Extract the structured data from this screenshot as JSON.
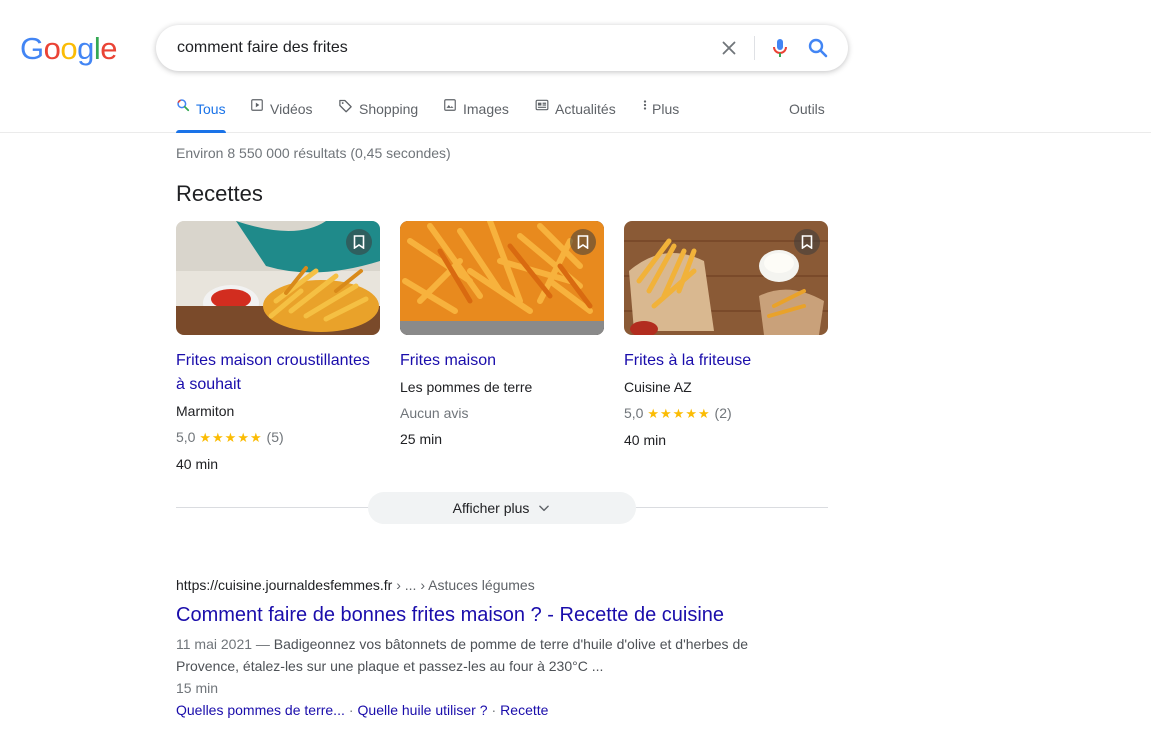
{
  "logo": {
    "letters": [
      "G",
      "o",
      "o",
      "g",
      "l",
      "e"
    ],
    "colors": [
      "#4285f4",
      "#ea4335",
      "#fbbc05",
      "#4285f4",
      "#34a853",
      "#ea4335"
    ]
  },
  "search": {
    "query": "comment faire des frites"
  },
  "tabs": [
    {
      "label": "Tous",
      "icon": "search-icon",
      "active": true
    },
    {
      "label": "Vidéos",
      "icon": "play-icon"
    },
    {
      "label": "Shopping",
      "icon": "tag-icon"
    },
    {
      "label": "Images",
      "icon": "image-icon"
    },
    {
      "label": "Actualités",
      "icon": "news-icon"
    },
    {
      "label": "Plus",
      "icon": "more-vert-icon"
    }
  ],
  "tools_label": "Outils",
  "stats": "Environ 8 550 000 résultats (0,45 secondes)",
  "section_title": "Recettes",
  "recipes": [
    {
      "title": "Frites maison croustillantes à souhait",
      "source": "Marmiton",
      "rating": "5,0",
      "stars": "★★★★★",
      "reviews": "(5)",
      "time": "40 min"
    },
    {
      "title": "Frites maison",
      "source": "Les pommes de terre",
      "meta": "Aucun avis",
      "time": "25 min"
    },
    {
      "title": "Frites à la friteuse",
      "source": "Cuisine AZ",
      "rating": "5,0",
      "stars": "★★★★★",
      "reviews": "(2)",
      "time": "40 min"
    }
  ],
  "more_button": "Afficher plus",
  "result": {
    "url": "https://cuisine.journaldesfemmes.fr",
    "breadcrumbs": " › ... › Astuces légumes",
    "title": "Comment faire de bonnes frites maison ? - Recette de cuisine",
    "date": "11 mai 2021 — ",
    "snippet": "Badigeonnez vos bâtonnets de pomme de terre d'huile d'olive et d'herbes de Provence, étalez-les sur une plaque et passez-les au four à 230°C ...",
    "time": "15 min",
    "links": [
      "Quelles pommes de terre...",
      "Quelle huile utiliser ?",
      "Recette"
    ]
  },
  "colors": {
    "link": "#1a0dab",
    "accent": "#1a73e8",
    "star": "#fbbc04"
  }
}
